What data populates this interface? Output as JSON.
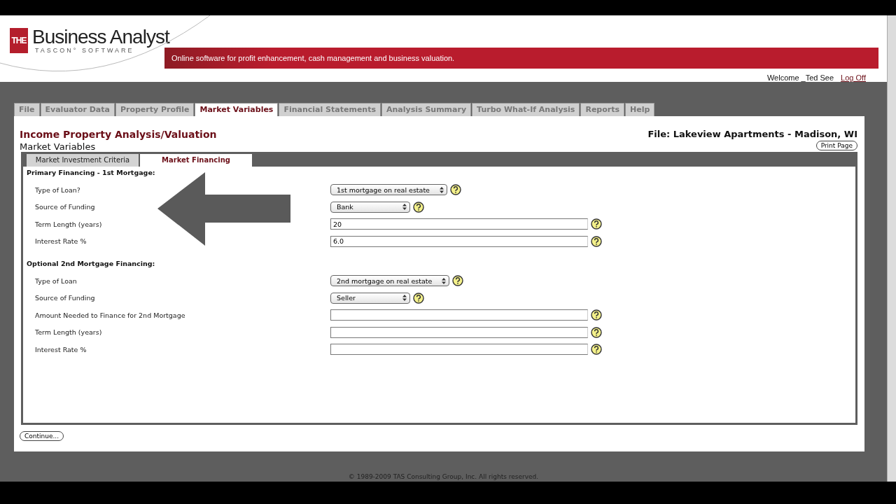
{
  "header": {
    "logo_mark": "THE",
    "logo_title": "Business Analyst",
    "logo_subtitle": "TASCON° SOFTWARE",
    "tagline": "Online software for profit enhancement, cash management and business valuation."
  },
  "user": {
    "welcome": "Welcome _Ted See",
    "logoff": "Log Off"
  },
  "tabs": [
    {
      "label": "File",
      "selected": false
    },
    {
      "label": "Evaluator Data",
      "selected": false
    },
    {
      "label": "Property Profile",
      "selected": false
    },
    {
      "label": "Market Variables",
      "selected": true
    },
    {
      "label": "Financial Statements",
      "selected": false
    },
    {
      "label": "Analysis Summary",
      "selected": false
    },
    {
      "label": "Turbo What-If Analysis",
      "selected": false
    },
    {
      "label": "Reports",
      "selected": false
    },
    {
      "label": "Help",
      "selected": false
    }
  ],
  "page": {
    "title": "Income Property Analysis/Valuation",
    "subtitle": "Market Variables",
    "file": "File: Lakeview Apartments - Madison, WI",
    "print_button": "Print Page"
  },
  "subtabs": [
    {
      "label": "Market Investment Criteria",
      "selected": false
    },
    {
      "label": "Market Financing",
      "selected": true
    }
  ],
  "sections": [
    {
      "heading": "Primary Financing - 1st Mortgage:",
      "fields": [
        {
          "label": "Type of Loan?",
          "kind": "select",
          "value": "1st mortgage on real estate"
        },
        {
          "label": "Source of Funding",
          "kind": "select",
          "value": "Bank"
        },
        {
          "label": "Term Length (years)",
          "kind": "text",
          "value": "20"
        },
        {
          "label": "Interest Rate %",
          "kind": "text",
          "value": "6.0"
        }
      ]
    },
    {
      "heading": "Optional 2nd Mortgage Financing:",
      "fields": [
        {
          "label": "Type of Loan",
          "kind": "select",
          "value": "2nd mortgage on real estate"
        },
        {
          "label": "Source of Funding",
          "kind": "select",
          "value": "Seller"
        },
        {
          "label": "Amount Needed to Finance for 2nd Mortgage",
          "kind": "text"
        },
        {
          "label": "Term Length (years)",
          "kind": "text"
        },
        {
          "label": "Interest Rate %",
          "kind": "text"
        }
      ]
    }
  ],
  "continue_button": "Continue...",
  "footer": "© 1989-2009 TAS Consulting Group, Inc. All rights reserved."
}
